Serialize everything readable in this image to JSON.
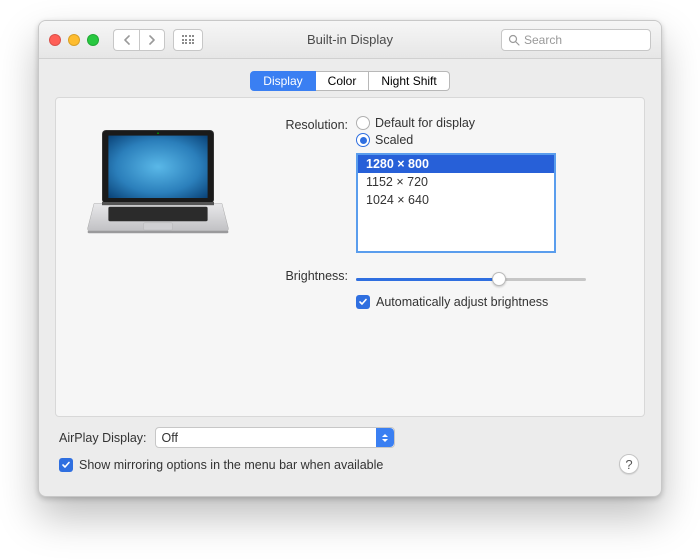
{
  "window": {
    "title": "Built-in Display",
    "search_placeholder": "Search"
  },
  "tabs": [
    {
      "label": "Display",
      "active": true
    },
    {
      "label": "Color",
      "active": false
    },
    {
      "label": "Night Shift",
      "active": false
    }
  ],
  "resolution": {
    "label": "Resolution:",
    "options": {
      "default": "Default for display",
      "scaled": "Scaled"
    },
    "selected": "scaled",
    "list": [
      {
        "value": "1280 × 800",
        "selected": true
      },
      {
        "value": "1152 × 720",
        "selected": false
      },
      {
        "value": "1024 × 640",
        "selected": false
      }
    ]
  },
  "brightness": {
    "label": "Brightness:",
    "value": 62,
    "auto_label": "Automatically adjust brightness",
    "auto_checked": true
  },
  "airplay": {
    "label": "AirPlay Display:",
    "value": "Off"
  },
  "mirroring": {
    "label": "Show mirroring options in the menu bar when available",
    "checked": true
  },
  "help": "?"
}
